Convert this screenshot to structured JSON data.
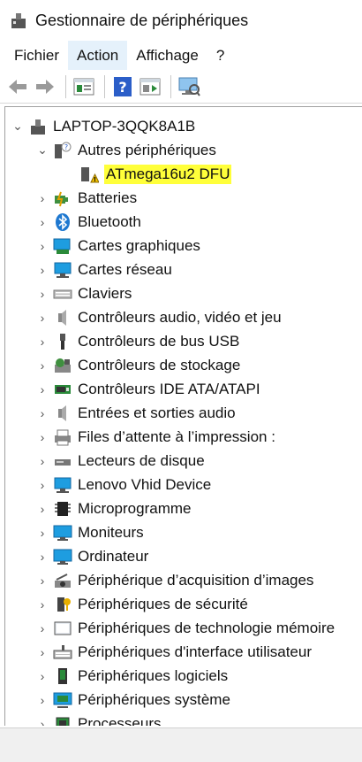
{
  "window": {
    "title": "Gestionnaire de périphériques"
  },
  "menubar": {
    "items": [
      "Fichier",
      "Action",
      "Affichage",
      "?"
    ],
    "active_index": 1
  },
  "toolbar": {
    "buttons": [
      "back-arrow-icon",
      "forward-arrow-icon",
      "properties-icon",
      "help-icon",
      "update-driver-icon",
      "scan-hardware-icon"
    ]
  },
  "tree": {
    "root": "LAPTOP-3QQK8A1B",
    "expanded_group": "Autres périphériques",
    "expanded_child": "ATmega16u2 DFU",
    "categories": [
      "Batteries",
      "Bluetooth",
      "Cartes graphiques",
      "Cartes réseau",
      "Claviers",
      "Contrôleurs audio, vidéo et jeu",
      "Contrôleurs de bus USB",
      "Contrôleurs de stockage",
      "Contrôleurs IDE ATA/ATAPI",
      "Entrées et sorties audio",
      "Files d’attente à l’impression :",
      "Lecteurs de disque",
      "Lenovo Vhid Device",
      "Microprogramme",
      "Moniteurs",
      "Ordinateur",
      "Périphérique d’acquisition d’images",
      "Périphériques de sécurité",
      "Périphériques de technologie mémoire",
      "Périphériques d'interface utilisateur",
      "Périphériques logiciels",
      "Périphériques système",
      "Processeurs"
    ]
  },
  "colors": {
    "highlight": "#ffff3a",
    "active_menu": "#e5f1fb",
    "icon_blue": "#1e78d0"
  }
}
